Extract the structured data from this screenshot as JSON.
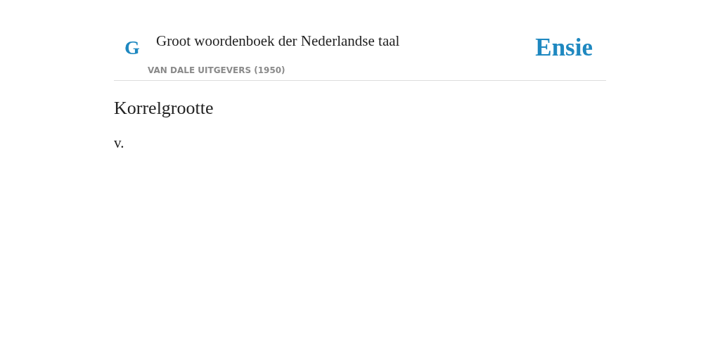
{
  "header": {
    "logo": "G",
    "title": "Groot woordenboek der Nederlandse taal",
    "publisher": "VAN DALE UITGEVERS (1950)",
    "brand": "Ensie"
  },
  "entry": {
    "term": "Korrelgrootte",
    "definition": "v."
  }
}
